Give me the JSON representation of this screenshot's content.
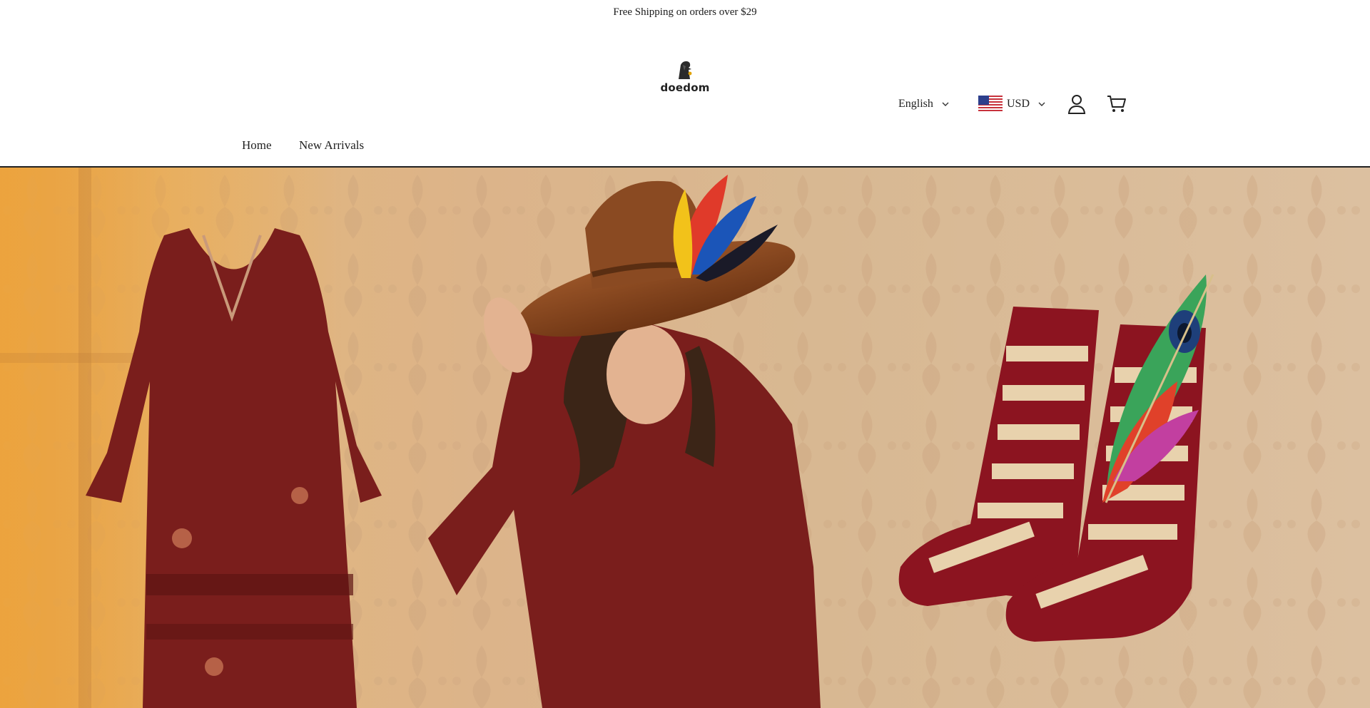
{
  "announcement": "Free Shipping on orders over $29",
  "logo": {
    "text": "doedom"
  },
  "header": {
    "language": "English",
    "currency": "USD",
    "icons": [
      "account-icon",
      "cart-icon"
    ]
  },
  "nav": {
    "items": [
      {
        "label": "Home"
      },
      {
        "label": "New Arrivals"
      }
    ]
  },
  "hero": {
    "description": "Boho floral maxi dress, woman in feathered brown cowboy hat, striped red socks with peacock feather"
  },
  "colors": {
    "dress": "#7a1e1c",
    "hat": "#8a4a22",
    "sock_red": "#8c1420",
    "sock_cream": "#e8d2ad",
    "wallpaper": "#d9b690"
  }
}
